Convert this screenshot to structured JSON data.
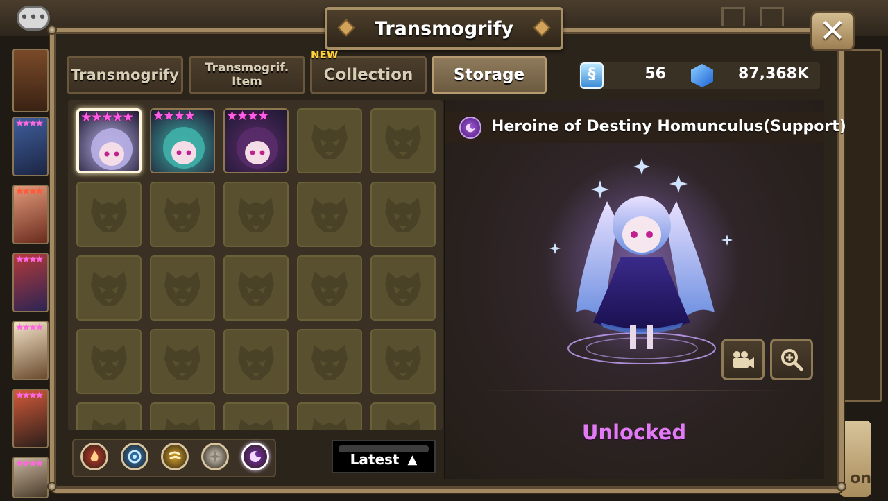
{
  "window": {
    "title": "Transmogrify"
  },
  "tabs": [
    {
      "label": "Transmogrify",
      "active": false
    },
    {
      "label_line1": "Transmogrif.",
      "label_line2": "Item",
      "active": false
    },
    {
      "label": "Collection",
      "active": false,
      "badge": "NEW"
    },
    {
      "label": "Storage",
      "active": true
    }
  ],
  "currency": {
    "scroll_icon": "transmogrify-scroll-icon",
    "scroll_count": "56",
    "crystal_icon": "mana-crystal-icon",
    "crystal_count": "87,368K"
  },
  "grid": {
    "monsters": [
      {
        "stars": "★★★★★",
        "star_count": 5,
        "color": "#b8b0e6",
        "selected": true
      },
      {
        "stars": "★★★★",
        "star_count": 4,
        "color": "#3fb0a8",
        "selected": false
      },
      {
        "stars": "★★★★",
        "star_count": 4,
        "color": "#5a2c6a",
        "selected": false
      }
    ],
    "empty_slot_icon": "empty-monster-silhouette-icon"
  },
  "filters": [
    {
      "element": "fire",
      "icon": "fire-element-icon",
      "color": "#c0392b",
      "active": false
    },
    {
      "element": "water",
      "icon": "water-element-icon",
      "color": "#2a7fc7",
      "active": false
    },
    {
      "element": "wind",
      "icon": "wind-element-icon",
      "color": "#d8a52a",
      "active": false
    },
    {
      "element": "light",
      "icon": "light-element-icon",
      "color": "#d9d3c5",
      "active": false
    },
    {
      "element": "dark",
      "icon": "dark-element-icon",
      "color": "#7a2fb0",
      "active": true
    }
  ],
  "sort": {
    "label": "Latest",
    "icon": "triangle-up-icon"
  },
  "detail": {
    "element_icon": "dark-element-icon",
    "name": "Heroine of Destiny Homunculus(Support)",
    "status": "Unlocked",
    "status_color": "#e07bf3",
    "buttons": [
      {
        "icon": "video-camera-icon"
      },
      {
        "icon": "zoom-in-icon"
      }
    ]
  },
  "background": {
    "right_button_text": "on",
    "side_cards_stars": [
      "★★★★",
      "★★★★",
      "★★★★",
      "★★★★",
      "★★★★",
      "★★★★",
      "★★★★"
    ]
  },
  "colors": {
    "accent": "#a38a63",
    "panel": "#3a3023",
    "slot": "#58502f",
    "stars": "#ff5ee6"
  }
}
